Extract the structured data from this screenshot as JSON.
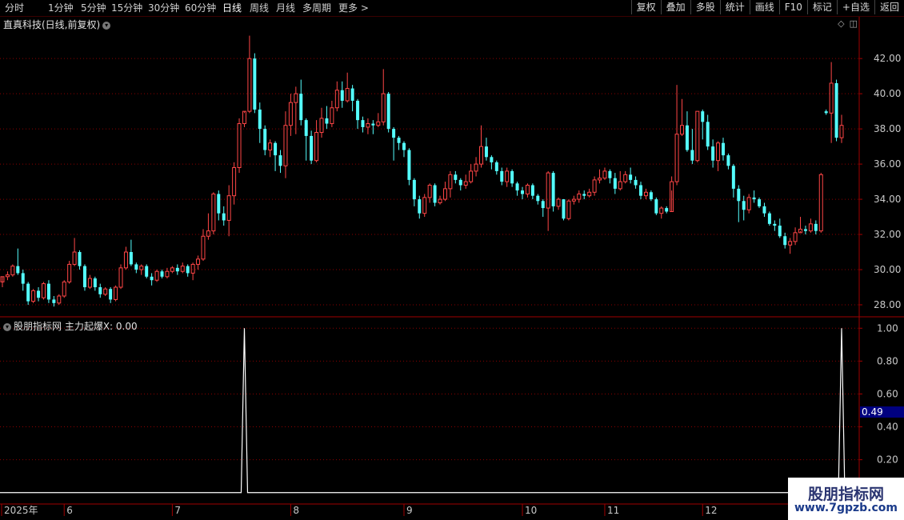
{
  "toolbar": {
    "periods": [
      "分时",
      "1分钟",
      "5分钟",
      "15分钟",
      "30分钟",
      "60分钟",
      "日线",
      "周线",
      "月线",
      "多周期",
      "更多 >"
    ],
    "active_period": "日线",
    "right_buttons": [
      "复权",
      "叠加",
      "多股",
      "统计",
      "画线",
      "F10",
      "标记",
      "+自选",
      "返回"
    ]
  },
  "main": {
    "title": "直真科技(日线,前复权)"
  },
  "indicator": {
    "title": "股朋指标网  主力起爆X: 0.00",
    "marker_value": "0.49"
  },
  "watermark": {
    "name": "股朋指标网",
    "url": "www.7gpzb.com"
  },
  "colors": {
    "up": "#ff4646",
    "down": "#54ffff",
    "grid": "#8b0000",
    "axis_text": "#c8c8c8",
    "line": "#ffffff",
    "marker_bg": "#000080"
  },
  "chart_data": [
    {
      "type": "candlestick",
      "y_ticks": [
        "42.00",
        "40.00",
        "38.00",
        "36.00",
        "34.00",
        "32.00",
        "30.00",
        "28.00"
      ],
      "ylim": [
        27.5,
        43.6
      ],
      "x_labels": [
        "2025年",
        "6",
        "7",
        "8",
        "9",
        "10",
        "11",
        "12"
      ],
      "x_label_index": [
        0,
        12,
        33,
        56,
        78,
        101,
        117,
        136
      ],
      "candles": [
        [
          29.3,
          29.6,
          29.2,
          29.0
        ],
        [
          29.6,
          29.7,
          29.9,
          29.4
        ],
        [
          29.7,
          30.2,
          30.3,
          29.6
        ],
        [
          30.2,
          29.8,
          31.2,
          29.7
        ],
        [
          29.8,
          29.2,
          30.0,
          28.8
        ],
        [
          29.2,
          28.2,
          29.3,
          28.0
        ],
        [
          28.2,
          28.8,
          28.9,
          28.1
        ],
        [
          28.8,
          28.4,
          29.0,
          28.2
        ],
        [
          28.4,
          29.2,
          29.3,
          28.3
        ],
        [
          29.2,
          28.3,
          29.4,
          28.1
        ],
        [
          28.3,
          28.1,
          28.5,
          27.9
        ],
        [
          28.1,
          28.5,
          28.6,
          28.0
        ],
        [
          28.5,
          29.3,
          29.4,
          28.4
        ],
        [
          29.3,
          30.3,
          30.5,
          29.2
        ],
        [
          30.3,
          31.0,
          31.8,
          30.2
        ],
        [
          31.0,
          30.2,
          31.1,
          30.0
        ],
        [
          30.2,
          29.0,
          30.3,
          28.8
        ],
        [
          29.0,
          29.5,
          29.7,
          28.9
        ],
        [
          29.5,
          29.0,
          29.6,
          28.8
        ],
        [
          29.0,
          28.6,
          29.2,
          28.4
        ],
        [
          28.6,
          28.9,
          29.0,
          28.5
        ],
        [
          28.9,
          28.3,
          29.0,
          28.1
        ],
        [
          28.3,
          29.0,
          29.1,
          28.2
        ],
        [
          29.0,
          30.1,
          30.3,
          28.9
        ],
        [
          30.1,
          31.0,
          31.3,
          30.0
        ],
        [
          31.0,
          30.3,
          31.7,
          30.2
        ],
        [
          30.3,
          30.0,
          30.4,
          29.8
        ],
        [
          30.0,
          30.2,
          30.3,
          29.7
        ],
        [
          30.2,
          29.6,
          30.3,
          29.5
        ],
        [
          29.6,
          29.4,
          29.8,
          29.1
        ],
        [
          29.4,
          29.9,
          30.0,
          29.3
        ],
        [
          29.9,
          29.6,
          30.0,
          29.5
        ],
        [
          29.6,
          29.9,
          30.1,
          29.5
        ],
        [
          29.9,
          30.1,
          30.2,
          29.8
        ],
        [
          30.1,
          29.9,
          30.3,
          29.7
        ],
        [
          29.9,
          30.2,
          30.4,
          29.8
        ],
        [
          30.2,
          29.8,
          30.3,
          29.6
        ],
        [
          29.8,
          30.3,
          30.4,
          29.4
        ],
        [
          30.3,
          30.6,
          30.8,
          30.0
        ],
        [
          30.6,
          31.9,
          32.3,
          30.5
        ],
        [
          31.9,
          32.2,
          33.2,
          31.7
        ],
        [
          32.2,
          34.3,
          34.4,
          32.0
        ],
        [
          34.3,
          33.2,
          34.5,
          32.8
        ],
        [
          33.2,
          32.8,
          33.6,
          32.5
        ],
        [
          32.8,
          34.2,
          34.8,
          31.9
        ],
        [
          34.2,
          35.8,
          36.1,
          33.7
        ],
        [
          35.8,
          38.3,
          38.6,
          35.5
        ],
        [
          38.3,
          39.0,
          38.9,
          38.1
        ],
        [
          39.0,
          42.0,
          43.3,
          38.9
        ],
        [
          42.0,
          39.1,
          42.3,
          38.9
        ],
        [
          39.1,
          38.0,
          39.5,
          37.2
        ],
        [
          38.0,
          36.8,
          38.2,
          36.5
        ],
        [
          36.8,
          37.2,
          37.4,
          36.4
        ],
        [
          37.2,
          36.5,
          37.3,
          35.6
        ],
        [
          36.5,
          35.9,
          36.8,
          35.5
        ],
        [
          35.9,
          38.2,
          39.0,
          35.2
        ],
        [
          38.2,
          39.5,
          40.0,
          37.6
        ],
        [
          39.5,
          40.0,
          40.4,
          37.7
        ],
        [
          40.0,
          38.5,
          40.8,
          38.2
        ],
        [
          38.5,
          37.6,
          38.6,
          36.2
        ],
        [
          37.6,
          36.2,
          37.9,
          36.0
        ],
        [
          36.2,
          37.8,
          38.5,
          36.1
        ],
        [
          37.8,
          38.6,
          39.2,
          37.5
        ],
        [
          38.6,
          38.3,
          39.3,
          38.0
        ],
        [
          38.3,
          39.2,
          39.6,
          38.1
        ],
        [
          39.2,
          40.2,
          40.7,
          39.0
        ],
        [
          40.2,
          39.6,
          40.7,
          39.2
        ],
        [
          39.6,
          40.3,
          41.2,
          39.5
        ],
        [
          40.3,
          39.6,
          40.5,
          39.0
        ],
        [
          39.6,
          38.5,
          39.7,
          38.0
        ],
        [
          38.5,
          38.1,
          38.7,
          37.8
        ],
        [
          38.1,
          38.3,
          38.6,
          37.7
        ],
        [
          38.3,
          38.2,
          38.5,
          37.7
        ],
        [
          38.2,
          38.4,
          38.9,
          38.1
        ],
        [
          38.4,
          40.0,
          41.4,
          38.2
        ],
        [
          40.0,
          38.0,
          40.1,
          37.8
        ],
        [
          38.0,
          37.5,
          38.1,
          36.2
        ],
        [
          37.5,
          37.2,
          37.6,
          36.8
        ],
        [
          37.2,
          36.8,
          37.3,
          36.4
        ],
        [
          36.8,
          35.1,
          36.9,
          34.8
        ],
        [
          35.1,
          34.0,
          35.2,
          33.6
        ],
        [
          34.0,
          33.2,
          34.2,
          32.9
        ],
        [
          33.2,
          34.1,
          34.3,
          33.0
        ],
        [
          34.1,
          34.8,
          34.9,
          33.8
        ],
        [
          34.8,
          33.8,
          34.9,
          33.6
        ],
        [
          33.8,
          34.0,
          34.2,
          33.7
        ],
        [
          34.0,
          34.6,
          35.0,
          33.9
        ],
        [
          34.6,
          35.4,
          35.6,
          34.1
        ],
        [
          35.4,
          35.1,
          35.6,
          34.9
        ],
        [
          35.1,
          34.8,
          35.2,
          34.5
        ],
        [
          34.8,
          35.0,
          35.4,
          34.6
        ],
        [
          35.0,
          35.6,
          36.0,
          34.9
        ],
        [
          35.6,
          36.0,
          36.4,
          35.3
        ],
        [
          36.0,
          37.0,
          38.2,
          35.8
        ],
        [
          37.0,
          36.4,
          37.5,
          36.2
        ],
        [
          36.4,
          36.1,
          36.5,
          35.7
        ],
        [
          36.1,
          35.6,
          36.2,
          35.4
        ],
        [
          35.6,
          35.0,
          35.8,
          34.8
        ],
        [
          35.0,
          35.6,
          35.8,
          34.7
        ],
        [
          35.6,
          34.9,
          35.7,
          34.7
        ],
        [
          34.9,
          34.5,
          35.0,
          34.2
        ],
        [
          34.5,
          34.3,
          34.7,
          34.0
        ],
        [
          34.3,
          34.8,
          34.9,
          34.1
        ],
        [
          34.8,
          34.2,
          34.9,
          34.0
        ],
        [
          34.2,
          33.9,
          34.3,
          33.7
        ],
        [
          33.9,
          33.5,
          34.0,
          33.0
        ],
        [
          33.5,
          35.5,
          35.6,
          32.2
        ],
        [
          35.5,
          33.6,
          35.6,
          33.3
        ],
        [
          33.6,
          34.0,
          34.1,
          33.4
        ],
        [
          34.0,
          32.9,
          34.0,
          32.8
        ],
        [
          32.9,
          33.9,
          34.0,
          32.8
        ],
        [
          33.9,
          34.0,
          34.2,
          33.7
        ],
        [
          34.0,
          34.3,
          34.5,
          33.8
        ],
        [
          34.3,
          34.2,
          34.5,
          34.0
        ],
        [
          34.2,
          34.4,
          34.6,
          34.1
        ],
        [
          34.4,
          35.1,
          35.3,
          34.2
        ],
        [
          35.1,
          35.2,
          35.7,
          34.9
        ],
        [
          35.2,
          35.6,
          35.8,
          35.1
        ],
        [
          35.6,
          35.2,
          35.7,
          34.9
        ],
        [
          35.2,
          34.6,
          35.5,
          34.3
        ],
        [
          34.6,
          35.0,
          35.6,
          34.5
        ],
        [
          35.0,
          35.4,
          35.6,
          34.9
        ],
        [
          35.4,
          35.1,
          35.8,
          34.9
        ],
        [
          35.1,
          34.8,
          35.3,
          34.6
        ],
        [
          34.8,
          34.2,
          35.0,
          34.0
        ],
        [
          34.2,
          34.4,
          34.6,
          34.0
        ],
        [
          34.4,
          34.0,
          34.5,
          33.9
        ],
        [
          34.0,
          33.2,
          34.1,
          33.1
        ],
        [
          33.2,
          33.5,
          33.6,
          32.9
        ],
        [
          33.5,
          33.3,
          33.6,
          33.2
        ],
        [
          33.3,
          35.0,
          35.3,
          34.5
        ],
        [
          35.0,
          37.7,
          40.5,
          34.8
        ],
        [
          37.7,
          38.2,
          39.7,
          37.6
        ],
        [
          38.2,
          36.8,
          39.0,
          36.7
        ],
        [
          36.8,
          36.2,
          38.0,
          36.0
        ],
        [
          36.2,
          39.0,
          39.0,
          36.1
        ],
        [
          39.0,
          38.4,
          39.1,
          37.4
        ],
        [
          38.4,
          37.0,
          38.8,
          36.8
        ],
        [
          37.0,
          36.2,
          37.4,
          35.8
        ],
        [
          36.2,
          37.2,
          37.3,
          35.6
        ],
        [
          37.2,
          36.5,
          37.5,
          36.2
        ],
        [
          36.5,
          35.9,
          36.6,
          35.7
        ],
        [
          35.9,
          34.6,
          36.0,
          34.1
        ],
        [
          34.6,
          33.9,
          34.8,
          32.7
        ],
        [
          33.9,
          33.4,
          34.2,
          32.8
        ],
        [
          33.4,
          34.1,
          34.3,
          33.2
        ],
        [
          34.1,
          34.0,
          34.5,
          33.8
        ],
        [
          34.0,
          33.6,
          34.1,
          33.5
        ],
        [
          33.6,
          33.2,
          33.8,
          33.0
        ],
        [
          33.2,
          32.6,
          33.3,
          32.5
        ],
        [
          32.6,
          32.5,
          32.8,
          32.2
        ],
        [
          32.5,
          31.9,
          32.9,
          31.8
        ],
        [
          31.9,
          31.4,
          32.1,
          31.2
        ],
        [
          31.4,
          31.6,
          31.8,
          30.9
        ],
        [
          31.6,
          32.1,
          32.4,
          31.4
        ],
        [
          32.1,
          32.3,
          33.0,
          32.2
        ],
        [
          32.3,
          32.2,
          32.5,
          32.0
        ],
        [
          32.2,
          32.6,
          32.9,
          32.1
        ],
        [
          32.6,
          32.2,
          32.8,
          32.0
        ],
        [
          32.2,
          35.4,
          35.5,
          32.1
        ],
        [
          39.0,
          38.9,
          39.1,
          38.8
        ],
        [
          38.9,
          40.6,
          41.8,
          37.2
        ],
        [
          40.6,
          37.5,
          40.8,
          37.3
        ],
        [
          37.5,
          38.2,
          38.8,
          37.2
        ]
      ]
    },
    {
      "type": "line",
      "title": "主力起爆X",
      "y_ticks": [
        "1.00",
        "0.80",
        "0.60",
        "0.40",
        "0.20"
      ],
      "ylim": [
        -0.05,
        1.05
      ],
      "spikes_at_candle_index": [
        47,
        163
      ]
    }
  ]
}
